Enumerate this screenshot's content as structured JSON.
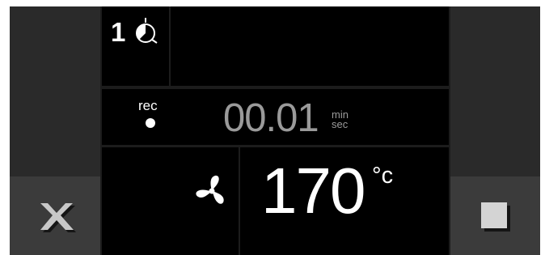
{
  "program": {
    "step_number": "1",
    "step_icon": "timer-icon"
  },
  "recording": {
    "label": "rec",
    "indicator_icon": "record-dot-icon"
  },
  "timer": {
    "value": "00.01",
    "unit_top": "min",
    "unit_bottom": "sec"
  },
  "fan": {
    "icon": "fan-icon"
  },
  "temperature": {
    "value": "170",
    "unit": "°c"
  },
  "buttons": {
    "cancel_icon": "close-x-icon",
    "stop_icon": "stop-square-icon"
  },
  "colors": {
    "screen_bg": "#1c1c1c",
    "panel_bg": "#000000",
    "side_bg": "#2a2a2a",
    "button_bg": "#3b3b3b",
    "text_primary": "#ffffff",
    "text_dim": "#9a9a9a",
    "icon_grey": "#c8c8c8"
  }
}
